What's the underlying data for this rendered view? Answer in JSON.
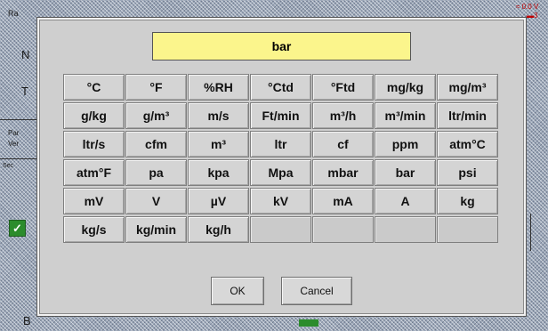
{
  "background": {
    "fragments": [
      "Ra",
      "N",
      "T",
      "Par",
      "Ver",
      "Sec",
      "B",
      "≈ 0.0 V",
      "▬3"
    ]
  },
  "dialog": {
    "selected_unit": "bar",
    "units": [
      "°C",
      "°F",
      "%RH",
      "°Ctd",
      "°Ftd",
      "mg/kg",
      "mg/m³",
      "g/kg",
      "g/m³",
      "m/s",
      "Ft/min",
      "m³/h",
      "m³/min",
      "ltr/min",
      "ltr/s",
      "cfm",
      "m³",
      "ltr",
      "cf",
      "ppm",
      "atm°C",
      "atm°F",
      "pa",
      "kpa",
      "Mpa",
      "mbar",
      "bar",
      "psi",
      "mV",
      "V",
      "µV",
      "kV",
      "mA",
      "A",
      "kg",
      "kg/s",
      "kg/min",
      "kg/h",
      "",
      "",
      "",
      ""
    ],
    "ok_label": "OK",
    "cancel_label": "Cancel"
  },
  "colors": {
    "display_background": "#fbf58c",
    "dialog_background": "#cfcfcf",
    "key_background": "#d4d4d4"
  }
}
